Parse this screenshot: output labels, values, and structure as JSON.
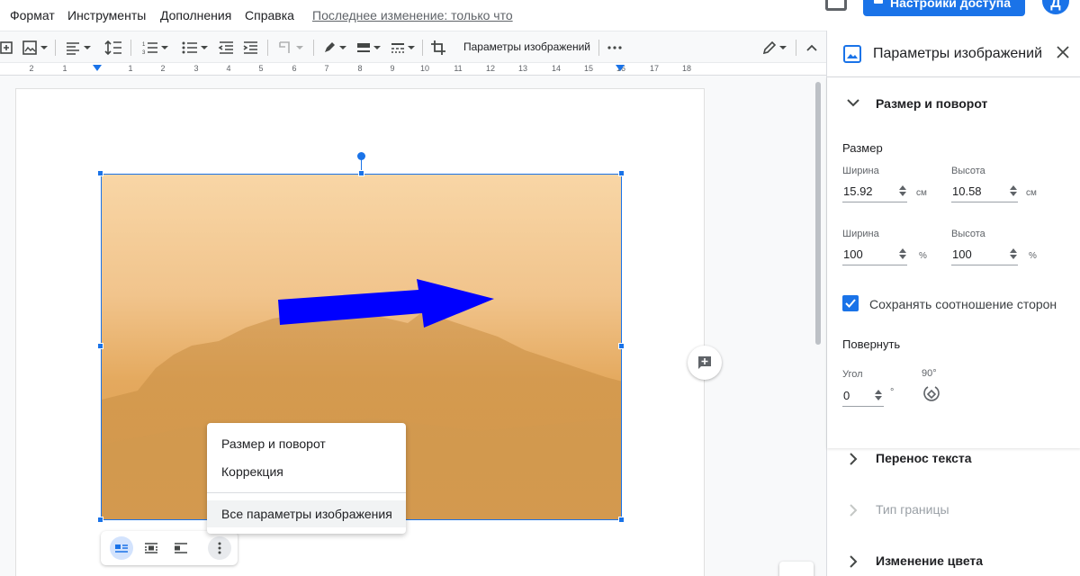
{
  "menubar": {
    "items": [
      "Формат",
      "Инструменты",
      "Дополнения",
      "Справка"
    ],
    "last_edit": "Последнее изменение: только что",
    "share_label": "Настройки доступа",
    "avatar_letter": "Д"
  },
  "toolbar": {
    "image_options_label": "Параметры изображений"
  },
  "ruler": {
    "numbers": [
      "2",
      "1",
      "1",
      "2",
      "3",
      "4",
      "5",
      "6",
      "7",
      "8",
      "9",
      "10",
      "11",
      "12",
      "13",
      "14",
      "15",
      "16",
      "17",
      "18"
    ]
  },
  "context_menu": {
    "items": [
      "Размер и поворот",
      "Коррекция",
      "Все параметры изображения"
    ]
  },
  "side_panel": {
    "title": "Параметры изображений",
    "size_rotate": {
      "title": "Размер и поворот",
      "size_label": "Размер",
      "width_label": "Ширина",
      "height_label": "Высота",
      "width_cm": "15.92",
      "height_cm": "10.58",
      "unit_cm": "см",
      "width_pct": "100",
      "height_pct": "100",
      "unit_pct": "%",
      "keep_ratio_label": "Сохранять соотношение сторон",
      "keep_ratio_checked": true,
      "rotate_label": "Повернуть",
      "angle_label": "Угол",
      "angle_value": "0",
      "angle_unit": "°",
      "rotate90_label": "90°"
    },
    "sections": [
      "Перенос текста",
      "Тип границы",
      "Изменение цвета"
    ]
  },
  "colors": {
    "accent": "#1a73e8",
    "arrow": "#0000ff"
  }
}
